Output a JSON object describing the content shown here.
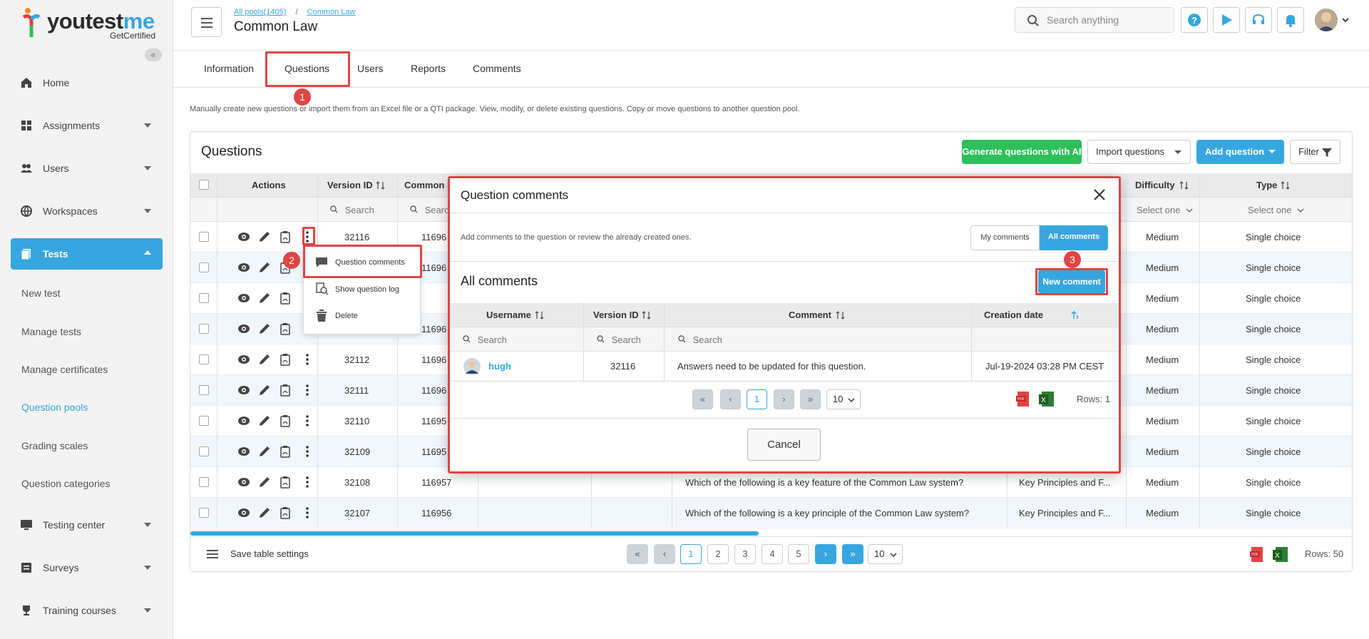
{
  "logo": {
    "brand_prefix": "youtest",
    "brand_suffix": "me",
    "tagline": "GetCertified"
  },
  "sidebar": {
    "items": [
      {
        "label": "Home",
        "icon": "home-icon"
      },
      {
        "label": "Assignments",
        "icon": "assignments-icon"
      },
      {
        "label": "Users",
        "icon": "users-icon"
      },
      {
        "label": "Workspaces",
        "icon": "globe-icon"
      },
      {
        "label": "Tests",
        "icon": "tests-icon"
      },
      {
        "label": "Testing center",
        "icon": "monitor-icon"
      },
      {
        "label": "Surveys",
        "icon": "surveys-icon"
      },
      {
        "label": "Training courses",
        "icon": "trophy-icon"
      }
    ],
    "sub_items": [
      "New test",
      "Manage tests",
      "Manage certificates",
      "Question pools",
      "Grading scales",
      "Question categories"
    ]
  },
  "header": {
    "breadcrumb_root": "All pools(1405)",
    "breadcrumb_sep": "/",
    "breadcrumb_current": "Common Law",
    "title": "Common Law",
    "search_placeholder": "Search anything"
  },
  "tabs": [
    "Information",
    "Questions",
    "Users",
    "Reports",
    "Comments"
  ],
  "description": "Manually create new questions or import them from an Excel file or a QTI package. View, modify, or delete existing questions. Copy or move questions to another question pool.",
  "questions": {
    "title": "Questions",
    "generate_label": "Generate questions with AI",
    "import_label": "Import questions",
    "add_label": "Add question",
    "filter_label": "Filter",
    "columns": {
      "actions": "Actions",
      "version_id": "Version ID",
      "common": "Common l",
      "difficulty": "Difficulty",
      "type": "Type"
    },
    "search_placeholder": "Search",
    "select_placeholder": "Select one",
    "rows": [
      {
        "version": "32116",
        "common": "11696",
        "question": "",
        "category": "",
        "difficulty": "Medium",
        "type": "Single choice"
      },
      {
        "version": "",
        "common": "11696",
        "question": "",
        "category": "",
        "difficulty": "Medium",
        "type": "Single choice"
      },
      {
        "version": "",
        "common": "",
        "question": "",
        "category": "",
        "difficulty": "Medium",
        "type": "Single choice"
      },
      {
        "version": "",
        "common": "11696",
        "question": "",
        "category": "",
        "difficulty": "Medium",
        "type": "Single choice"
      },
      {
        "version": "32112",
        "common": "11696",
        "question": "",
        "category": "",
        "difficulty": "Medium",
        "type": "Single choice"
      },
      {
        "version": "32111",
        "common": "11696",
        "question": "",
        "category": "",
        "difficulty": "Medium",
        "type": "Single choice"
      },
      {
        "version": "32110",
        "common": "11695",
        "question": "",
        "category": "",
        "difficulty": "Medium",
        "type": "Single choice"
      },
      {
        "version": "32109",
        "common": "11695",
        "question": "",
        "category": "",
        "difficulty": "Medium",
        "type": "Single choice"
      },
      {
        "version": "32108",
        "common": "116957",
        "question": "Which of the following is a key feature of the Common Law system?",
        "category": "Key Principles and F...",
        "difficulty": "Medium",
        "type": "Single choice"
      },
      {
        "version": "32107",
        "common": "116956",
        "question": "Which of the following is a key principle of the Common Law system?",
        "category": "Key Principles and F...",
        "difficulty": "Medium",
        "type": "Single choice"
      }
    ],
    "save_settings": "Save table settings",
    "pages": [
      "1",
      "2",
      "3",
      "4",
      "5"
    ],
    "page_size": "10",
    "rows_label": "Rows: 50"
  },
  "menu": {
    "items": [
      "Question comments",
      "Show question log",
      "Delete"
    ]
  },
  "modal": {
    "title": "Question comments",
    "description": "Add comments to the question or review the already created ones.",
    "my_comments": "My comments",
    "all_comments": "All comments",
    "section_title": "All comments",
    "new_comment": "New comment",
    "columns": {
      "username": "Username",
      "version_id": "Version ID",
      "comment": "Comment",
      "creation_date": "Creation date"
    },
    "search_placeholder": "Search",
    "rows": [
      {
        "username": "hugh",
        "version_id": "32116",
        "comment": "Answers need to be updated for this question.",
        "creation_date": "Jul-19-2024 03:28 PM CEST"
      }
    ],
    "page": "1",
    "page_size": "10",
    "rows_label": "Rows: 1",
    "cancel": "Cancel"
  },
  "annotations": [
    "1",
    "2",
    "3"
  ],
  "colors": {
    "accent": "#37a6e0",
    "green": "#2ebf5a",
    "highlight": "#e04444"
  }
}
